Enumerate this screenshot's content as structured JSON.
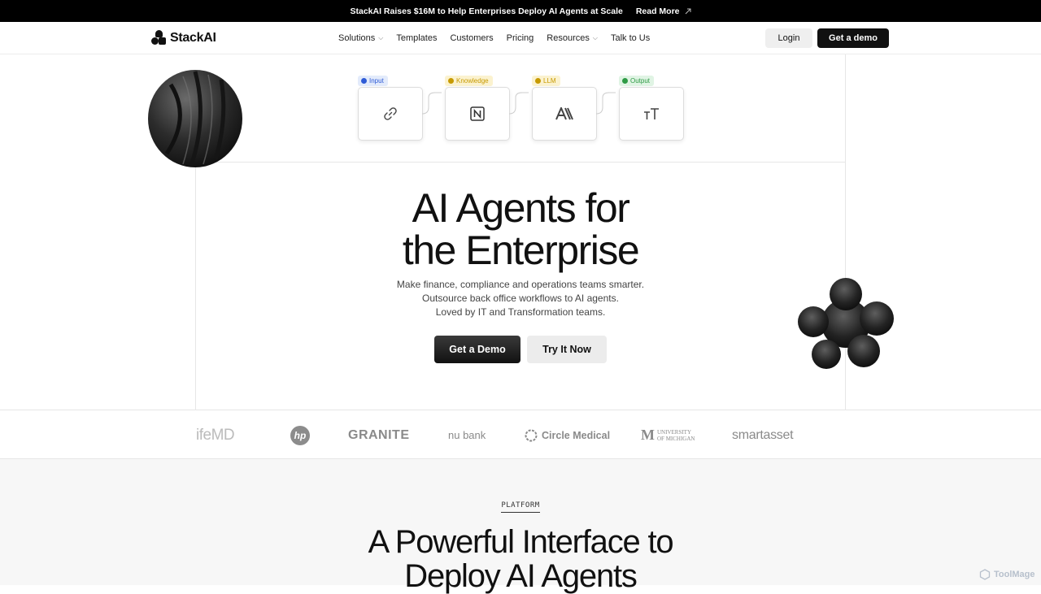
{
  "announcement": {
    "text": "StackAI Raises $16M to Help Enterprises Deploy AI Agents at Scale",
    "link_label": "Read More",
    "link_icon": "arrow-up-right-icon"
  },
  "nav": {
    "brand": "StackAI",
    "items": [
      {
        "label": "Solutions",
        "dropdown": true
      },
      {
        "label": "Templates",
        "dropdown": false
      },
      {
        "label": "Customers",
        "dropdown": false
      },
      {
        "label": "Pricing",
        "dropdown": false
      },
      {
        "label": "Resources",
        "dropdown": true
      },
      {
        "label": "Talk to Us",
        "dropdown": false
      }
    ],
    "login_label": "Login",
    "demo_label": "Get a demo"
  },
  "workflow": {
    "nodes": [
      {
        "tag": "Input",
        "tag_color": "#2f5bd6",
        "tag_bg": "#e3ebfb",
        "icon": "link-icon"
      },
      {
        "tag": "Knowledge",
        "tag_color": "#c79a00",
        "tag_bg": "#fbf2cf",
        "icon": "notion-icon"
      },
      {
        "tag": "LLM",
        "tag_color": "#c79a00",
        "tag_bg": "#fbf2cf",
        "icon": "anthropic-icon"
      },
      {
        "tag": "Output",
        "tag_color": "#2e9a45",
        "tag_bg": "#e0f4e4",
        "icon": "text-size-icon"
      }
    ]
  },
  "hero": {
    "title_line1": "AI Agents for",
    "title_line2": "the Enterprise",
    "sub_line1": "Make finance, compliance and operations teams smarter.",
    "sub_line2": "Outsource back office workflows to AI agents.",
    "sub_line3": "Loved by IT and Transformation teams.",
    "primary_cta": "Get a Demo",
    "secondary_cta": "Try It Now"
  },
  "logos": [
    "ifeMD",
    "hp",
    "GRANITE",
    "nu bank",
    "Circle Medical",
    "UNIVERSITY OF MICHIGAN",
    "smartasset"
  ],
  "platform": {
    "eyebrow": "PLATFORM",
    "title_line1": "A Powerful Interface to",
    "title_line2": "Deploy AI Agents"
  },
  "watermark": "ToolMage"
}
